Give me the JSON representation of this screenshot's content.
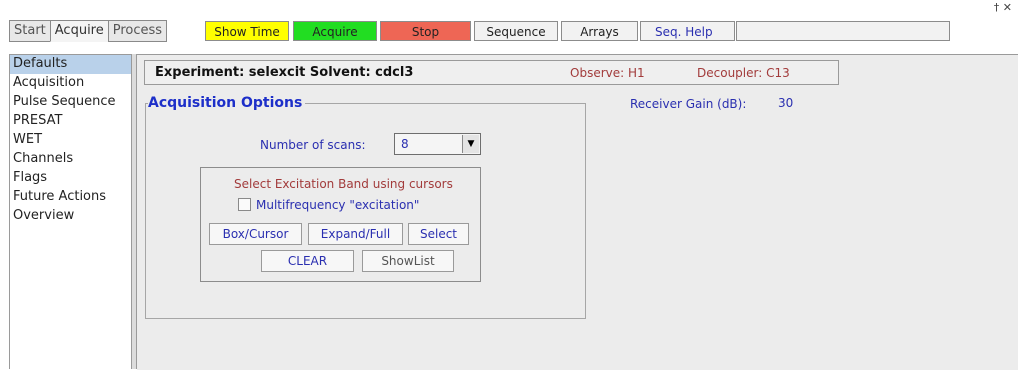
{
  "tabs": [
    {
      "label": "Start"
    },
    {
      "label": "Acquire"
    },
    {
      "label": "Process"
    }
  ],
  "toolbar": {
    "show_time": "Show Time",
    "acquire": "Acquire",
    "stop": "Stop",
    "sequence": "Sequence",
    "arrays": "Arrays",
    "seq_help": "Seq. Help",
    "pin_icon_text": "† ✕",
    "colors": {
      "show_time": "#ffff00",
      "acquire": "#22dd22",
      "stop": "#ee6655"
    }
  },
  "sidebar": {
    "items": [
      {
        "label": "Defaults"
      },
      {
        "label": "Acquisition"
      },
      {
        "label": "Pulse Sequence"
      },
      {
        "label": "PRESAT"
      },
      {
        "label": "WET"
      },
      {
        "label": "Channels"
      },
      {
        "label": "Flags"
      },
      {
        "label": "Future Actions"
      },
      {
        "label": "Overview"
      }
    ]
  },
  "experiment": {
    "text": "Experiment: selexcit   Solvent: cdcl3",
    "observe": "Observe: H1",
    "decoupler": "Decoupler: C13"
  },
  "acq": {
    "title": "Acquisition Options",
    "receiver_gain_label": "Receiver Gain (dB):",
    "receiver_gain_value": "30",
    "scans_label": "Number of scans:",
    "scans_value": "8"
  },
  "excitation": {
    "title": "Select Excitation Band using cursors",
    "multifreq_label": "Multifrequency \"excitation\"",
    "box_cursor": "Box/Cursor",
    "expand_full": "Expand/Full",
    "select": "Select",
    "clear": "CLEAR",
    "showlist": "ShowList"
  }
}
